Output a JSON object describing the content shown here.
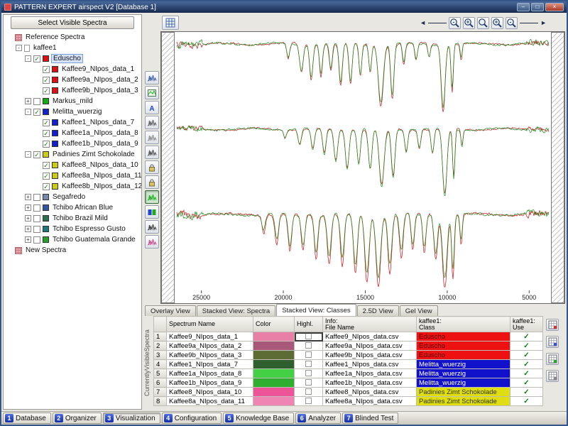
{
  "window": {
    "title": "PATTERN EXPERT airspect V2 [Database 1]",
    "buttons": [
      {
        "name": "minimize-button",
        "glyph": "–"
      },
      {
        "name": "maximize-button",
        "glyph": "□"
      },
      {
        "name": "close-button",
        "glyph": "×"
      }
    ]
  },
  "sidebar": {
    "button": "Select Visible Spectra",
    "tree": [
      {
        "label": "Reference Spectra",
        "level": 0,
        "icon": "grid"
      },
      {
        "label": "kaffee1",
        "level": 1,
        "expander": "minus",
        "icon": "doc"
      },
      {
        "label": "Eduscho",
        "level": 2,
        "expander": "minus",
        "checked": true,
        "color": "#dd1111",
        "selected": true
      },
      {
        "label": "Kaffee9_NIpos_data_1",
        "level": 3,
        "checked": true,
        "color": "#dd1111"
      },
      {
        "label": "Kaffee9a_NIpos_data_2",
        "level": 3,
        "checked": true,
        "color": "#dd1111"
      },
      {
        "label": "Kaffee9b_NIpos_data_3",
        "level": 3,
        "checked": true,
        "color": "#dd1111"
      },
      {
        "label": "Markus_mild",
        "level": 2,
        "expander": "plus",
        "checked": false,
        "color": "#11aa11"
      },
      {
        "label": "Melitta_wuerzig",
        "level": 2,
        "expander": "minus",
        "checked": true,
        "color": "#1122cc"
      },
      {
        "label": "Kaffee1_NIpos_data_7",
        "level": 3,
        "checked": true,
        "color": "#1122cc"
      },
      {
        "label": "Kaffee1a_NIpos_data_8",
        "level": 3,
        "checked": true,
        "color": "#1122cc"
      },
      {
        "label": "Kaffee1b_NIpos_data_9",
        "level": 3,
        "checked": true,
        "color": "#1122cc"
      },
      {
        "label": "Padinies Zimt Schokolade",
        "level": 2,
        "expander": "minus",
        "checked": true,
        "color": "#cccc11"
      },
      {
        "label": "Kaffee8_NIpos_data_10",
        "level": 3,
        "checked": true,
        "color": "#cccc11"
      },
      {
        "label": "Kaffee8a_NIpos_data_11",
        "level": 3,
        "checked": true,
        "color": "#cccc11"
      },
      {
        "label": "Kaffee8b_NIpos_data_12",
        "level": 3,
        "checked": true,
        "color": "#cccc11"
      },
      {
        "label": "Segafredo",
        "level": 2,
        "expander": "plus",
        "checked": false,
        "color": "#7788aa"
      },
      {
        "label": "Tchibo African Blue",
        "level": 2,
        "expander": "plus",
        "checked": false,
        "color": "#3355a0"
      },
      {
        "label": "Tchibo Brazil Mild",
        "level": 2,
        "expander": "plus",
        "checked": false,
        "color": "#2e6e50"
      },
      {
        "label": "Tchibo Espresso Gusto",
        "level": 2,
        "expander": "plus",
        "checked": false,
        "color": "#1e7878"
      },
      {
        "label": "Tchibo Guatemala Grande",
        "level": 2,
        "expander": "plus",
        "checked": false,
        "color": "#2aa02a"
      },
      {
        "label": "New Spectra",
        "level": 0,
        "icon": "grid"
      }
    ]
  },
  "zoom_toolbar": [
    {
      "name": "zoom-out-horizontal-icon",
      "sign": "-"
    },
    {
      "name": "zoom-in-horizontal-icon",
      "sign": "+"
    },
    {
      "name": "zoom-reset-icon",
      "sign": ""
    },
    {
      "name": "zoom-in-vertical-icon",
      "sign": "+"
    },
    {
      "name": "zoom-out-vertical-icon",
      "sign": "-"
    }
  ],
  "vtoolbar": [
    {
      "name": "magnify-spectrum-icon",
      "type": "spectrum",
      "color": "#3355aa"
    },
    {
      "name": "export-spectrum-image-icon",
      "type": "image",
      "color": "#22aa22"
    },
    {
      "name": "annotate-icon",
      "type": "letter",
      "glyph": "A",
      "color": "#2244cc"
    },
    {
      "name": "peak-pick-icon",
      "type": "spectrum",
      "color": "#555555"
    },
    {
      "name": "integrate-icon",
      "type": "spectrum",
      "color": "#888888"
    },
    {
      "name": "derivative-icon",
      "type": "spectrum",
      "color": "#444444"
    },
    {
      "name": "lock-x-axis-icon",
      "type": "lock"
    },
    {
      "name": "lock-y-axis-icon",
      "type": "lock"
    },
    {
      "name": "show-spectra-icon",
      "type": "spectrum",
      "color": "#11aa11",
      "active": true
    },
    {
      "name": "class-color-icon",
      "type": "dual",
      "colors": [
        "#2244cc",
        "#22aa22"
      ]
    },
    {
      "name": "baseline-correct-icon",
      "type": "spectrum",
      "color": "#333333"
    },
    {
      "name": "highlight-trace-icon",
      "type": "spectrum",
      "color": "#cc4488"
    }
  ],
  "plot": {
    "x_ticks": [
      25000,
      20000,
      15000,
      10000,
      5000
    ],
    "x_range": [
      26500,
      3800
    ],
    "panels": [
      {
        "noise": 1.1,
        "dips": [
          [
            19700,
            90,
            22
          ],
          [
            18900,
            110,
            40
          ],
          [
            18300,
            100,
            50
          ],
          [
            17700,
            90,
            45
          ],
          [
            17100,
            90,
            38
          ],
          [
            16500,
            100,
            60
          ],
          [
            15900,
            95,
            58
          ],
          [
            15300,
            85,
            46
          ],
          [
            14700,
            80,
            40
          ],
          [
            14050,
            150,
            88
          ],
          [
            13350,
            100,
            78
          ],
          [
            12650,
            85,
            30
          ],
          [
            11900,
            80,
            24
          ],
          [
            11100,
            75,
            18
          ],
          [
            10250,
            120,
            95
          ],
          [
            9700,
            70,
            68
          ],
          [
            9150,
            60,
            22
          ]
        ],
        "traces": [
          {
            "color": "#b41919",
            "scale": 1.0
          },
          {
            "color": "#1f8c1f",
            "scale": 0.93
          }
        ]
      },
      {
        "noise": 1.0,
        "dips": [
          [
            19900,
            80,
            12
          ],
          [
            19000,
            100,
            22
          ],
          [
            18200,
            100,
            30
          ],
          [
            17500,
            100,
            36
          ],
          [
            16800,
            110,
            45
          ],
          [
            16100,
            110,
            55
          ],
          [
            15400,
            100,
            50
          ],
          [
            14700,
            110,
            58
          ],
          [
            14000,
            150,
            82
          ],
          [
            13300,
            110,
            68
          ],
          [
            12500,
            90,
            32
          ],
          [
            11700,
            90,
            26
          ],
          [
            10900,
            90,
            35
          ],
          [
            10150,
            130,
            96
          ],
          [
            9600,
            70,
            70
          ],
          [
            9100,
            60,
            24
          ]
        ],
        "traces": [
          {
            "color": "#b41919",
            "scale": 0.97
          },
          {
            "color": "#1f8c1f",
            "scale": 1.0
          }
        ]
      },
      {
        "noise": 1.4,
        "dips": [
          [
            21200,
            100,
            25
          ],
          [
            20400,
            110,
            40
          ],
          [
            19600,
            110,
            50
          ],
          [
            18800,
            110,
            48
          ],
          [
            18000,
            110,
            58
          ],
          [
            17200,
            120,
            66
          ],
          [
            16400,
            115,
            70
          ],
          [
            15600,
            120,
            80
          ],
          [
            14900,
            130,
            92
          ],
          [
            14200,
            140,
            96
          ],
          [
            13500,
            120,
            78
          ],
          [
            12800,
            110,
            58
          ],
          [
            12100,
            100,
            48
          ],
          [
            11400,
            100,
            52
          ],
          [
            10700,
            110,
            60
          ],
          [
            10150,
            140,
            100
          ],
          [
            9650,
            80,
            85
          ],
          [
            9150,
            70,
            40
          ]
        ],
        "traces": [
          {
            "color": "#cc1111",
            "scale": 1.06
          },
          {
            "color": "#1f8c1f",
            "scale": 0.9
          }
        ]
      }
    ]
  },
  "view_tabs": [
    {
      "label": "Overlay View"
    },
    {
      "label": "Stacked View: Spectra"
    },
    {
      "label": "Stacked View: Classes",
      "active": true
    },
    {
      "label": "2.5D View"
    },
    {
      "label": "Gel View"
    }
  ],
  "table": {
    "side_label": "CurrentlyVisibleSpectra",
    "columns": [
      "",
      "Spectrum Name",
      "Color",
      "Highl.",
      "Info:\nFile Name",
      "kaffee1:\nClass",
      "kaffee1:\nUse"
    ],
    "rows": [
      {
        "num": "1",
        "name": "Kaffee9_NIpos_data_1",
        "color": "#e87fa6",
        "file": "Kaffee9_NIpos_data.csv",
        "class": "Eduscho",
        "class_bg": "#ee1111",
        "class_fg": "#550000",
        "use": true,
        "focus": true
      },
      {
        "num": "2",
        "name": "Kaffee9a_NIpos_data_2",
        "color": "#a85878",
        "file": "Kaffee9a_NIpos_data.csv",
        "class": "Eduscho",
        "class_bg": "#ee1111",
        "class_fg": "#550000",
        "use": true
      },
      {
        "num": "3",
        "name": "Kaffee9b_NIpos_data_3",
        "color": "#5c6c34",
        "file": "Kaffee9b_NIpos_data.csv",
        "class": "Eduscho",
        "class_bg": "#ee1111",
        "class_fg": "#550000",
        "use": true
      },
      {
        "num": "4",
        "name": "Kaffee1_NIpos_data_7",
        "color": "#2f5e2f",
        "file": "Kaffee1_NIpos_data.csv",
        "class": "Melitta_wuerzig",
        "class_bg": "#1111cc",
        "class_fg": "#ffffff",
        "use": true
      },
      {
        "num": "5",
        "name": "Kaffee1a_NIpos_data_8",
        "color": "#44d044",
        "file": "Kaffee1a_NIpos_data.csv",
        "class": "Melitta_wuerzig",
        "class_bg": "#1111cc",
        "class_fg": "#ffffff",
        "use": true
      },
      {
        "num": "6",
        "name": "Kaffee1b_NIpos_data_9",
        "color": "#2fae2f",
        "file": "Kaffee1b_NIpos_data.csv",
        "class": "Melitta_wuerzig",
        "class_bg": "#1111cc",
        "class_fg": "#ffffff",
        "use": true
      },
      {
        "num": "7",
        "name": "Kaffee8_NIpos_data_10",
        "color": "#ee5599",
        "file": "Kaffee8_NIpos_data.csv",
        "class": "Padinies Zimt Schokolade",
        "class_bg": "#dede12",
        "class_fg": "#333300",
        "use": true
      },
      {
        "num": "8",
        "name": "Kaffee8a_NIpos_data_11",
        "color": "#ef85b2",
        "file": "Kaffee8a_NIpos_data.csv",
        "class": "Padinies Zimt Schokolade",
        "class_bg": "#dede12",
        "class_fg": "#333300",
        "use": true
      }
    ]
  },
  "table_icons": [
    {
      "name": "table-add-icon",
      "accent": "#cc3333"
    },
    {
      "name": "table-copy-icon",
      "accent": "#3355cc"
    },
    {
      "name": "table-export-icon",
      "accent": "#22aa22"
    },
    {
      "name": "table-refresh-icon",
      "accent": "#888888"
    }
  ],
  "bottom_tabs": [
    {
      "num": "1",
      "label": "Database"
    },
    {
      "num": "2",
      "label": "Organizer"
    },
    {
      "num": "3",
      "label": "Visualization",
      "active": true
    },
    {
      "num": "4",
      "label": "Configuration"
    },
    {
      "num": "5",
      "label": "Knowledge Base"
    },
    {
      "num": "6",
      "label": "Analyzer"
    },
    {
      "num": "7",
      "label": "Blinded Test"
    }
  ]
}
